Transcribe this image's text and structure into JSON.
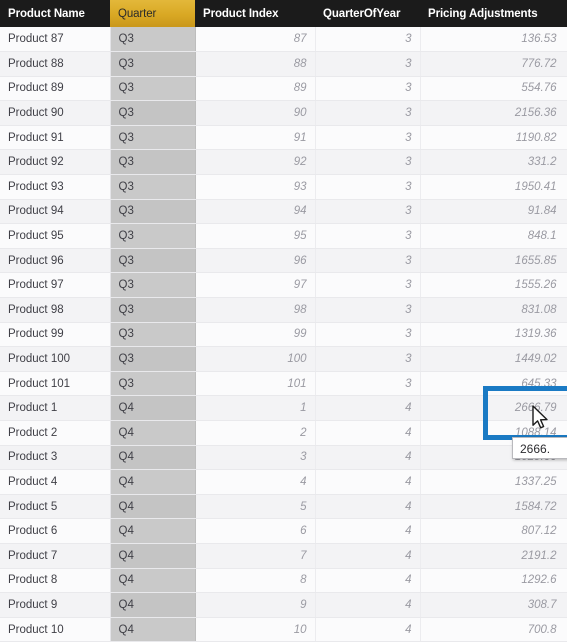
{
  "table": {
    "columns": [
      {
        "key": "product_name",
        "label": "Product Name",
        "selected": false
      },
      {
        "key": "quarter",
        "label": "Quarter",
        "selected": true
      },
      {
        "key": "product_index",
        "label": "Product Index",
        "selected": false
      },
      {
        "key": "quarter_of_year",
        "label": "QuarterOfYear",
        "selected": false
      },
      {
        "key": "pricing_adjustments",
        "label": "Pricing Adjustments",
        "selected": false
      }
    ],
    "rows": [
      {
        "product_name": "Product 87",
        "quarter": "Q3",
        "product_index": "87",
        "quarter_of_year": "3",
        "pricing_adjustments": "136.53"
      },
      {
        "product_name": "Product 88",
        "quarter": "Q3",
        "product_index": "88",
        "quarter_of_year": "3",
        "pricing_adjustments": "776.72"
      },
      {
        "product_name": "Product 89",
        "quarter": "Q3",
        "product_index": "89",
        "quarter_of_year": "3",
        "pricing_adjustments": "554.76"
      },
      {
        "product_name": "Product 90",
        "quarter": "Q3",
        "product_index": "90",
        "quarter_of_year": "3",
        "pricing_adjustments": "2156.36"
      },
      {
        "product_name": "Product 91",
        "quarter": "Q3",
        "product_index": "91",
        "quarter_of_year": "3",
        "pricing_adjustments": "1190.82"
      },
      {
        "product_name": "Product 92",
        "quarter": "Q3",
        "product_index": "92",
        "quarter_of_year": "3",
        "pricing_adjustments": "331.2"
      },
      {
        "product_name": "Product 93",
        "quarter": "Q3",
        "product_index": "93",
        "quarter_of_year": "3",
        "pricing_adjustments": "1950.41"
      },
      {
        "product_name": "Product 94",
        "quarter": "Q3",
        "product_index": "94",
        "quarter_of_year": "3",
        "pricing_adjustments": "91.84"
      },
      {
        "product_name": "Product 95",
        "quarter": "Q3",
        "product_index": "95",
        "quarter_of_year": "3",
        "pricing_adjustments": "848.1"
      },
      {
        "product_name": "Product 96",
        "quarter": "Q3",
        "product_index": "96",
        "quarter_of_year": "3",
        "pricing_adjustments": "1655.85"
      },
      {
        "product_name": "Product 97",
        "quarter": "Q3",
        "product_index": "97",
        "quarter_of_year": "3",
        "pricing_adjustments": "1555.26"
      },
      {
        "product_name": "Product 98",
        "quarter": "Q3",
        "product_index": "98",
        "quarter_of_year": "3",
        "pricing_adjustments": "831.08"
      },
      {
        "product_name": "Product 99",
        "quarter": "Q3",
        "product_index": "99",
        "quarter_of_year": "3",
        "pricing_adjustments": "1319.36"
      },
      {
        "product_name": "Product 100",
        "quarter": "Q3",
        "product_index": "100",
        "quarter_of_year": "3",
        "pricing_adjustments": "1449.02"
      },
      {
        "product_name": "Product 101",
        "quarter": "Q3",
        "product_index": "101",
        "quarter_of_year": "3",
        "pricing_adjustments": "645.33"
      },
      {
        "product_name": "Product 1",
        "quarter": "Q4",
        "product_index": "1",
        "quarter_of_year": "4",
        "pricing_adjustments": "2666.79"
      },
      {
        "product_name": "Product 2",
        "quarter": "Q4",
        "product_index": "2",
        "quarter_of_year": "4",
        "pricing_adjustments": "1088.14"
      },
      {
        "product_name": "Product 3",
        "quarter": "Q4",
        "product_index": "3",
        "quarter_of_year": "4",
        "pricing_adjustments": "1029.66"
      },
      {
        "product_name": "Product 4",
        "quarter": "Q4",
        "product_index": "4",
        "quarter_of_year": "4",
        "pricing_adjustments": "1337.25"
      },
      {
        "product_name": "Product 5",
        "quarter": "Q4",
        "product_index": "5",
        "quarter_of_year": "4",
        "pricing_adjustments": "1584.72"
      },
      {
        "product_name": "Product 6",
        "quarter": "Q4",
        "product_index": "6",
        "quarter_of_year": "4",
        "pricing_adjustments": "807.12"
      },
      {
        "product_name": "Product 7",
        "quarter": "Q4",
        "product_index": "7",
        "quarter_of_year": "4",
        "pricing_adjustments": "2191.2"
      },
      {
        "product_name": "Product 8",
        "quarter": "Q4",
        "product_index": "8",
        "quarter_of_year": "4",
        "pricing_adjustments": "1292.6"
      },
      {
        "product_name": "Product 9",
        "quarter": "Q4",
        "product_index": "9",
        "quarter_of_year": "4",
        "pricing_adjustments": "308.7"
      },
      {
        "product_name": "Product 10",
        "quarter": "Q4",
        "product_index": "10",
        "quarter_of_year": "4",
        "pricing_adjustments": "700.8"
      }
    ]
  },
  "selection": {
    "cell_row_index": 15,
    "cell_column_key": "pricing_adjustments",
    "cell_value": "2666.79",
    "border_color": "#1a7ac4"
  },
  "tooltip": {
    "text": "2666."
  },
  "cursor": {
    "icon": "arrow-pointer-icon"
  },
  "colors": {
    "header_background": "#1b1b1b",
    "header_selected_background": "#d9a824",
    "quarter_column_highlight": "#c9c9c9",
    "row_background": "#fbfbfc",
    "row_alt_background": "#f3f3f5",
    "numeric_text": "#9a9aa2",
    "name_text": "#3f3f46"
  }
}
